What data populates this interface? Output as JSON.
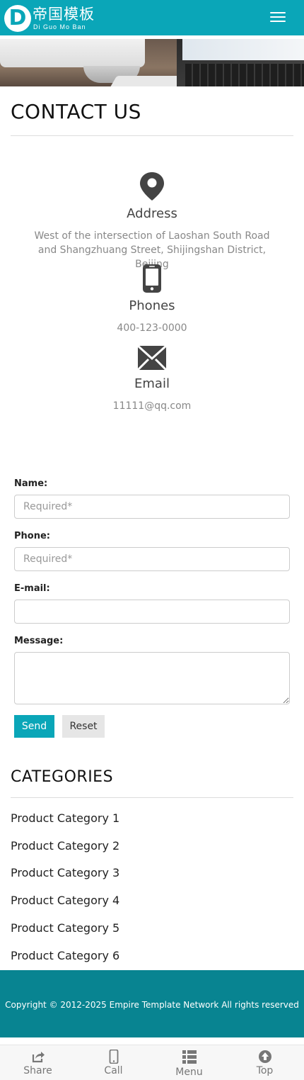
{
  "header": {
    "logo_letter": "D",
    "brand_cn": "帝国模板",
    "brand_en": "Di Guo Mo Ban",
    "menu_icon": "hamburger-menu-icon",
    "accent_color": "#0aa6b8"
  },
  "contact": {
    "title": "CONTACT US",
    "address": {
      "icon": "map-pin-icon",
      "heading": "Address",
      "text": "West of the intersection of Laoshan South Road and Shangzhuang Street, Shijingshan District, Beijing"
    },
    "phones": {
      "icon": "mobile-phone-icon",
      "heading": "Phones",
      "text": "400-123-0000"
    },
    "email": {
      "icon": "envelope-icon",
      "heading": "Email",
      "text": "11111@qq.com"
    }
  },
  "form": {
    "name_label": "Name:",
    "name_placeholder": "Required*",
    "phone_label": "Phone:",
    "phone_placeholder": "Required*",
    "email_label": "E-mail:",
    "email_placeholder": "",
    "message_label": "Message:",
    "send_label": "Send",
    "reset_label": "Reset"
  },
  "categories": {
    "title": "CATEGORIES",
    "items": [
      "Product Category 1",
      "Product Category 2",
      "Product Category 3",
      "Product Category 4",
      "Product Category 5",
      "Product Category 6"
    ]
  },
  "footer": {
    "copyright": "Copyright © 2012-2025 Empire Template Network All rights reserved",
    "background_color": "#088491"
  },
  "bottom_nav": [
    {
      "label": "Share",
      "icon": "share-icon"
    },
    {
      "label": "Call",
      "icon": "phone-icon"
    },
    {
      "label": "Menu",
      "icon": "list-icon"
    },
    {
      "label": "Top",
      "icon": "arrow-up-circle-icon"
    }
  ]
}
